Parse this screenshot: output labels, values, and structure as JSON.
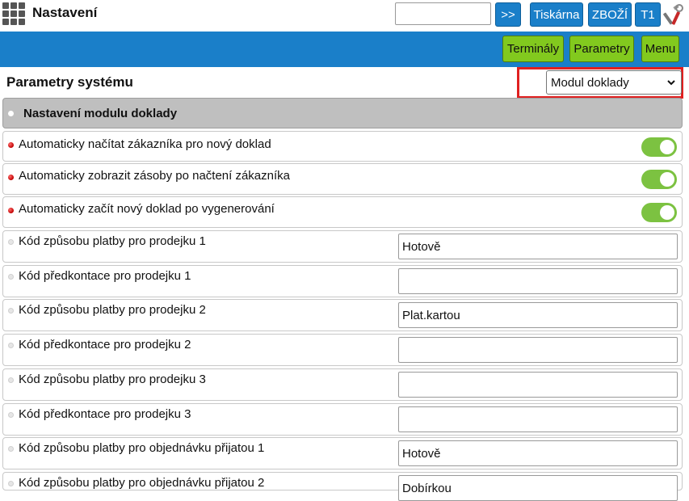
{
  "header": {
    "title": "Nastavení",
    "search_value": "",
    "go_label": ">>",
    "printer_label": "Tiskárna",
    "goods_label": "ZBOŽÍ",
    "terminal_label": "T1"
  },
  "nav": {
    "terminals_label": "Terminály",
    "parameters_label": "Parametry",
    "menu_label": "Menu"
  },
  "page": {
    "title": "Parametry systému",
    "module_select": "Modul doklady",
    "group_title": "Nastavení modulu doklady"
  },
  "toggles": [
    {
      "label": "Automaticky načítat zákazníka pro nový doklad",
      "on": true
    },
    {
      "label": "Automaticky zobrazit zásoby po načtení zákazníka",
      "on": true
    },
    {
      "label": "Automaticky začít nový doklad po vygenerování",
      "on": true
    }
  ],
  "fields": [
    {
      "label": "Kód způsobu platby pro prodejku 1",
      "value": "Hotově"
    },
    {
      "label": "Kód předkontace pro prodejku 1",
      "value": ""
    },
    {
      "label": "Kód způsobu platby pro prodejku 2",
      "value": "Plat.kartou"
    },
    {
      "label": "Kód předkontace pro prodejku 2",
      "value": ""
    },
    {
      "label": "Kód způsobu platby pro prodejku 3",
      "value": ""
    },
    {
      "label": "Kód předkontace pro prodejku 3",
      "value": ""
    },
    {
      "label": "Kód způsobu platby pro objednávku přijatou 1",
      "value": "Hotově"
    },
    {
      "label": "Kód způsobu platby pro objednávku přijatou 2",
      "value": "Dobírkou"
    }
  ],
  "colors": {
    "primary_blue": "#1a7fc9",
    "action_green": "#82c91e",
    "toggle_green": "#7cc241",
    "highlight_red": "#e02020"
  },
  "icons": {
    "apps": "grid-icon",
    "tools": "tools-icon",
    "select_arrow": "chevron-down-icon"
  }
}
